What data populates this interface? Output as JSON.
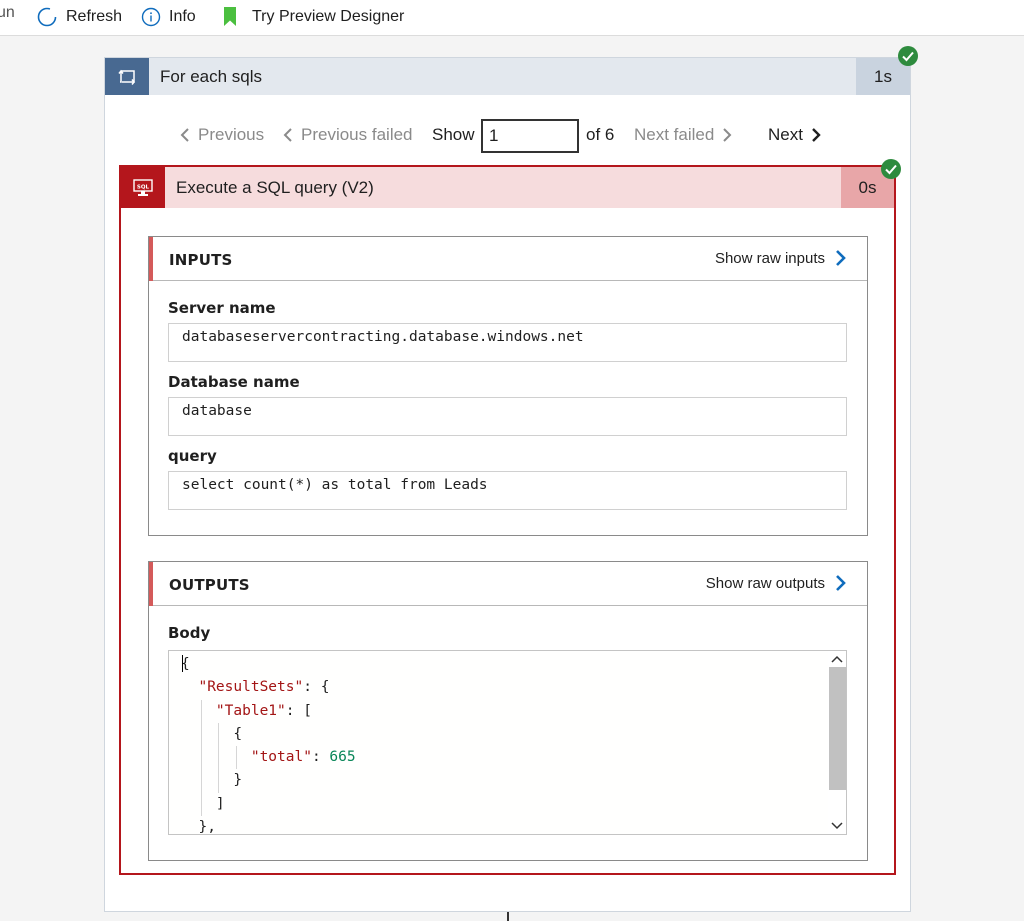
{
  "toolbar": {
    "run_label": "un",
    "refresh_label": "Refresh",
    "info_label": "Info",
    "preview_label": "Try Preview Designer"
  },
  "foreach": {
    "title": "For each sqls",
    "duration": "1s",
    "status": "succeeded"
  },
  "pager": {
    "previous": "Previous",
    "previous_failed": "Previous failed",
    "show": "Show",
    "current": "1",
    "of": "of 6",
    "next_failed": "Next failed",
    "next": "Next"
  },
  "action": {
    "title": "Execute a SQL query (V2)",
    "duration": "0s",
    "icon_text": "SQL",
    "status": "succeeded"
  },
  "inputs": {
    "title": "INPUTS",
    "raw_link": "Show raw inputs",
    "fields": [
      {
        "label": "Server name",
        "value": "databaseservercontracting.database.windows.net"
      },
      {
        "label": "Database name",
        "value": "database"
      },
      {
        "label": "query",
        "value": "select count(*) as total from Leads"
      }
    ]
  },
  "outputs": {
    "title": "OUTPUTS",
    "raw_link": "Show raw outputs",
    "body_label": "Body",
    "code_lines": [
      {
        "indent": 0,
        "parts": [
          {
            "t": "p",
            "v": "{"
          }
        ]
      },
      {
        "indent": 1,
        "parts": [
          {
            "t": "k",
            "v": "\"ResultSets\""
          },
          {
            "t": "p",
            "v": ": {"
          }
        ]
      },
      {
        "indent": 2,
        "parts": [
          {
            "t": "k",
            "v": "\"Table1\""
          },
          {
            "t": "p",
            "v": ": ["
          }
        ]
      },
      {
        "indent": 3,
        "parts": [
          {
            "t": "p",
            "v": "{"
          }
        ]
      },
      {
        "indent": 4,
        "parts": [
          {
            "t": "k",
            "v": "\"total\""
          },
          {
            "t": "p",
            "v": ": "
          },
          {
            "t": "n",
            "v": "665"
          }
        ]
      },
      {
        "indent": 3,
        "parts": [
          {
            "t": "p",
            "v": "}"
          }
        ]
      },
      {
        "indent": 2,
        "parts": [
          {
            "t": "p",
            "v": "]"
          }
        ]
      },
      {
        "indent": 1,
        "parts": [
          {
            "t": "p",
            "v": "},"
          }
        ]
      }
    ]
  },
  "colors": {
    "success": "#2e8b3e",
    "failed_border": "#b4161c",
    "link_blue": "#0f6cbd",
    "foreach_icon_bg": "#486991"
  }
}
